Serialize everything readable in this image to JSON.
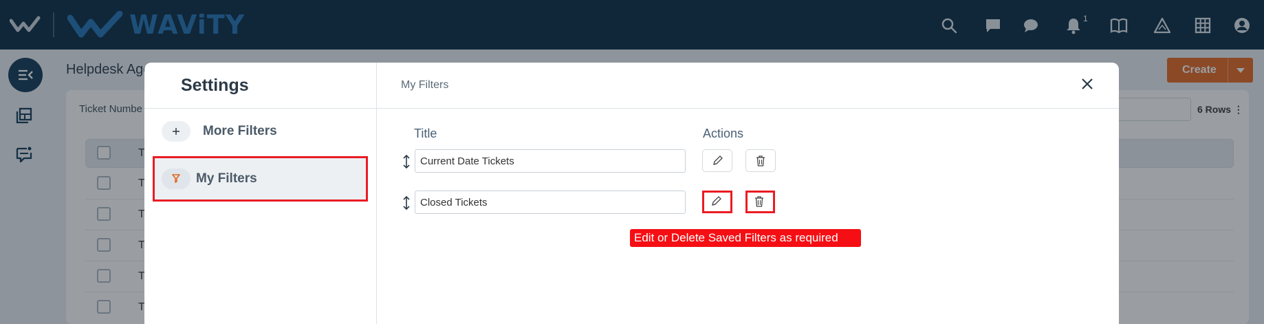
{
  "app": {
    "brand_name": "WAViTY",
    "notification_count": "1"
  },
  "topbar": {
    "icons": [
      "search-icon",
      "comment-icon",
      "chat-bubble-icon",
      "bell-icon",
      "book-icon",
      "delta-icon",
      "grid-icon",
      "user-icon"
    ]
  },
  "background_page": {
    "title": "Helpdesk Age",
    "create_label": "Create",
    "ticket_label": "Ticket Numbe",
    "rows_label": "6 Rows",
    "row_letter": "T"
  },
  "modal": {
    "title": "Settings",
    "breadcrumb": "My Filters",
    "sidebar": [
      {
        "icon": "+",
        "label": "More Filters",
        "active": false
      },
      {
        "icon": "filter",
        "label": "My Filters",
        "active": true
      }
    ],
    "columns": {
      "title": "Title",
      "actions": "Actions"
    },
    "filters": [
      {
        "title": "Current Date Tickets"
      },
      {
        "title": "Closed Tickets"
      }
    ],
    "callout": "Edit or Delete Saved Filters as required"
  },
  "colors": {
    "topbar": "#03273f",
    "accent": "#e3651d",
    "highlight": "#ea1c23"
  }
}
